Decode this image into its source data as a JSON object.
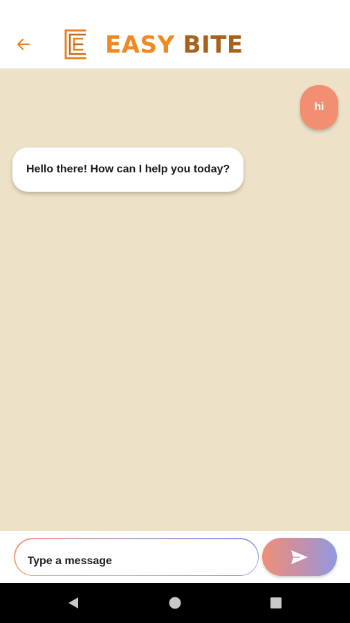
{
  "header": {
    "brand_word1": "EASY",
    "brand_word2": "BITE",
    "back_icon": "arrow-left-icon",
    "logo_icon": "easy-bite-logo-mark",
    "brand_color_primary": "#ef8a20",
    "brand_color_secondary": "#a8611a"
  },
  "chat": {
    "background": "#ede1c7",
    "messages": [
      {
        "sender": "user",
        "text": "hi",
        "color": "#f28e71"
      },
      {
        "sender": "bot",
        "text": "Hello there! How can I help you today?",
        "color": "#ffffff"
      }
    ]
  },
  "composer": {
    "placeholder": "Type a message",
    "value": "",
    "send_icon": "send-icon"
  },
  "system_nav": {
    "back_icon": "triangle-back-icon",
    "home_icon": "circle-home-icon",
    "recents_icon": "square-recents-icon"
  }
}
